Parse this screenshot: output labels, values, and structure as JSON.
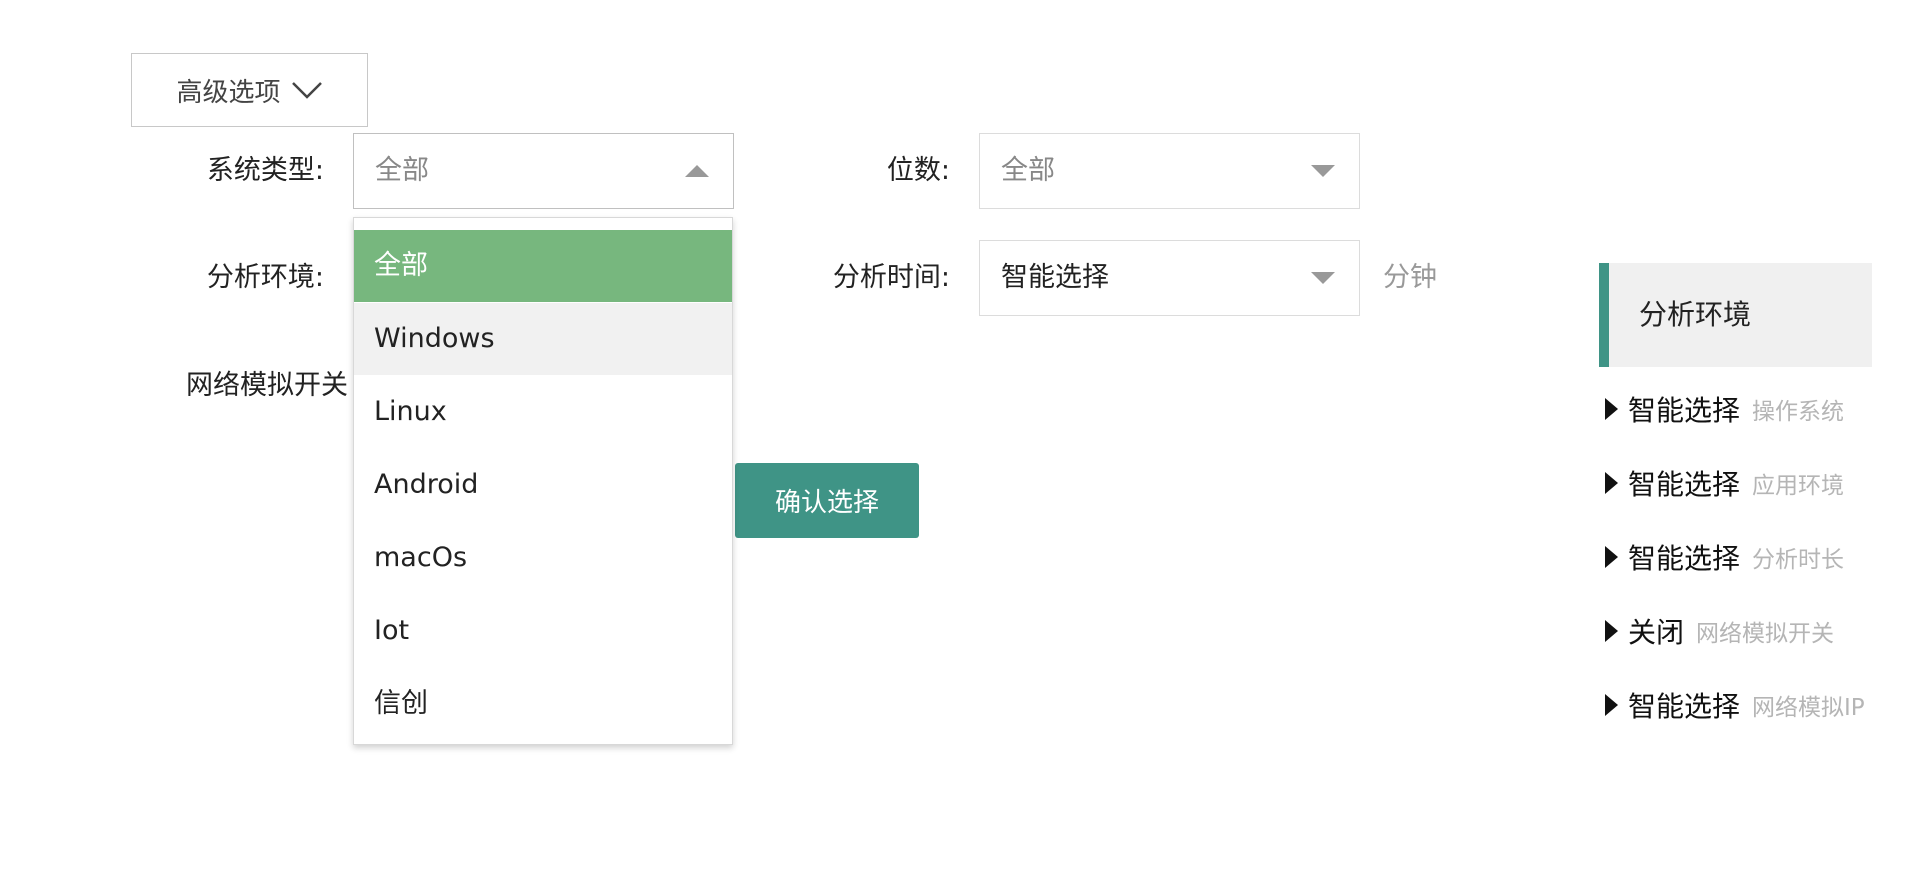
{
  "advanced_toggle": {
    "label": "高级选项"
  },
  "form": {
    "system_type": {
      "label": "系统类型:",
      "value": "全部"
    },
    "bits": {
      "label": "位数:",
      "value": "全部"
    },
    "analysis_env": {
      "label": "分析环境:"
    },
    "analysis_time": {
      "label": "分析时间:",
      "value": "智能选择",
      "unit": "分钟"
    },
    "network_switch": {
      "label": "网络模拟开关"
    }
  },
  "dropdown": {
    "options": [
      "全部",
      "Windows",
      "Linux",
      "Android",
      "macOs",
      "Iot",
      "信创"
    ],
    "selected_index": 0,
    "hover_index": 1
  },
  "confirm_button": {
    "label": "确认选择"
  },
  "summary": {
    "title": "分析环境",
    "rows": [
      {
        "value": "智能选择",
        "key": "操作系统"
      },
      {
        "value": "智能选择",
        "key": "应用环境"
      },
      {
        "value": "智能选择",
        "key": "分析时长"
      },
      {
        "value": "关闭",
        "key": "网络模拟开关"
      },
      {
        "value": "智能选择",
        "key": "网络模拟IP"
      }
    ]
  },
  "colors": {
    "accent": "#3f9486",
    "selected_option": "#77b77e",
    "hover_option": "#f1f1f1",
    "muted_text": "#b5b5b5"
  },
  "icons": {
    "advanced_toggle": "chevron-down-icon",
    "select_open": "caret-up-icon",
    "select_closed": "caret-down-icon",
    "summary_bullet": "caret-right-icon"
  }
}
